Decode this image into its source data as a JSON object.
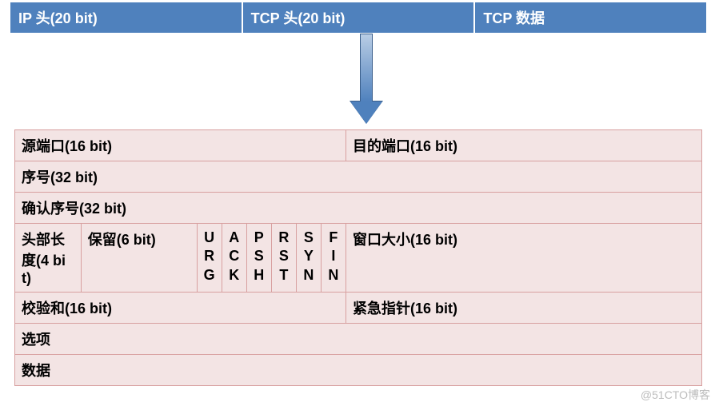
{
  "packet": {
    "ip_header": "IP 头(20 bit)",
    "tcp_header": "TCP 头(20 bit)",
    "tcp_data": "TCP 数据"
  },
  "tcp": {
    "src_port": "源端口(16 bit)",
    "dst_port": "目的端口(16 bit)",
    "seq": "序号(32 bit)",
    "ack_seq": "确认序号(32 bit)",
    "hdr_len": "头部长度(4 bit)",
    "reserved": "保留(6 bit)",
    "flags": {
      "urg": "U\nR\nG",
      "ack": "A\nC\nK",
      "psh": "P\nS\nH",
      "rst": "R\nS\nT",
      "syn": "S\nY\nN",
      "fin": "F\nI\nN"
    },
    "window": "窗口大小(16 bit)",
    "checksum": "校验和(16 bit)",
    "urgent_ptr": "紧急指针(16 bit)",
    "options": "选项",
    "data": "数据"
  },
  "watermark": "@51CTO博客"
}
